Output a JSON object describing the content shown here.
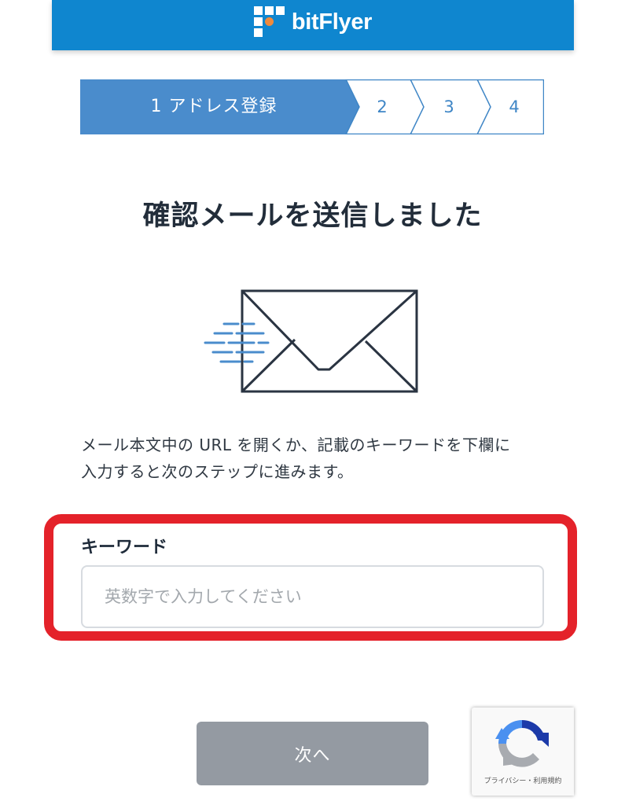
{
  "header": {
    "brand": "bitFlyer"
  },
  "stepper": {
    "steps": [
      {
        "label": "1 アドレス登録",
        "active": true
      },
      {
        "label": "2",
        "active": false
      },
      {
        "label": "3",
        "active": false
      },
      {
        "label": "4",
        "active": false
      }
    ]
  },
  "main": {
    "title": "確認メールを送信しました",
    "description_line1": "メール本文中の URL を開くか、記載のキーワードを下欄に",
    "description_line2": "入力すると次のステップに進みます。",
    "keyword_label": "キーワード",
    "keyword_placeholder": "英数字で入力してください",
    "keyword_value": "",
    "next_button": "次へ"
  },
  "recaptcha": {
    "links": "プライバシー・利用規約"
  },
  "colors": {
    "brand_blue": "#0f86cf",
    "step_active": "#4a8ccc",
    "highlight_red": "#e4222a",
    "button_disabled": "#949aa2"
  },
  "icons": [
    "bitflyer-logo-icon",
    "envelope-icon",
    "recaptcha-icon"
  ]
}
